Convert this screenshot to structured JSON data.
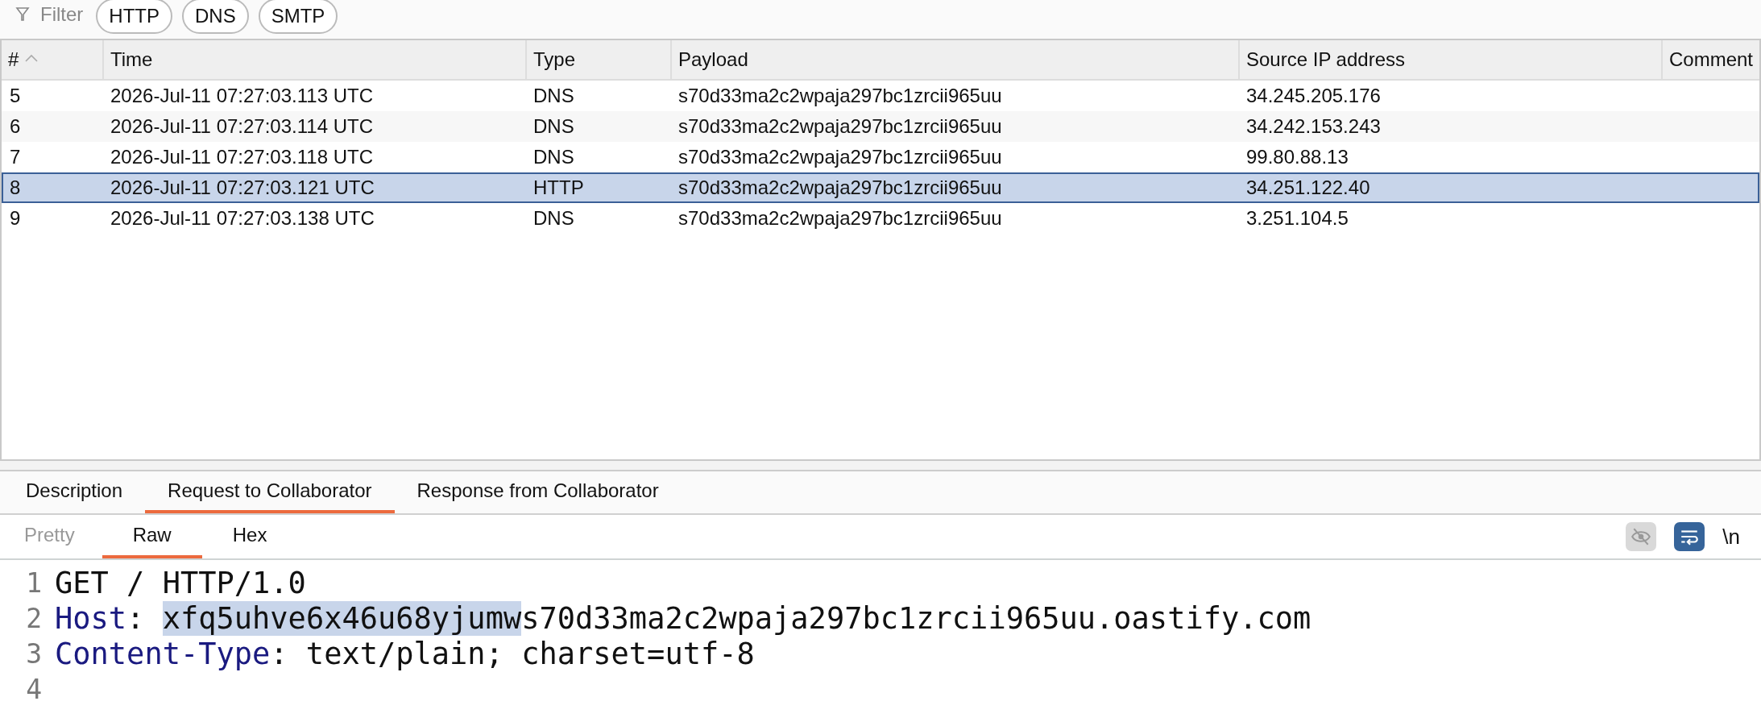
{
  "filter": {
    "label": "Filter",
    "chips": [
      "HTTP",
      "DNS",
      "SMTP"
    ]
  },
  "table": {
    "columns": [
      {
        "label": "#",
        "sorted": true
      },
      {
        "label": "Time",
        "sorted": false
      },
      {
        "label": "Type",
        "sorted": false
      },
      {
        "label": "Payload",
        "sorted": false
      },
      {
        "label": "Source IP address",
        "sorted": false
      },
      {
        "label": "Comment",
        "sorted": false
      }
    ],
    "rows": [
      {
        "cells": [
          "5",
          "2026-Jul-11 07:27:03.113 UTC",
          "DNS",
          "s70d33ma2c2wpaja297bc1zrcii965uu",
          "34.245.205.176"
        ],
        "selected": false
      },
      {
        "cells": [
          "6",
          "2026-Jul-11 07:27:03.114 UTC",
          "DNS",
          "s70d33ma2c2wpaja297bc1zrcii965uu",
          "34.242.153.243"
        ],
        "selected": false
      },
      {
        "cells": [
          "7",
          "2026-Jul-11 07:27:03.118 UTC",
          "DNS",
          "s70d33ma2c2wpaja297bc1zrcii965uu",
          "99.80.88.13"
        ],
        "selected": false
      },
      {
        "cells": [
          "8",
          "2026-Jul-11 07:27:03.121 UTC",
          "HTTP",
          "s70d33ma2c2wpaja297bc1zrcii965uu",
          "34.251.122.40"
        ],
        "selected": true
      },
      {
        "cells": [
          "9",
          "2026-Jul-11 07:27:03.138 UTC",
          "DNS",
          "s70d33ma2c2wpaja297bc1zrcii965uu",
          "3.251.104.5"
        ],
        "selected": false
      }
    ]
  },
  "detail_tabs": [
    {
      "label": "Description",
      "selected": false
    },
    {
      "label": "Request to Collaborator",
      "selected": true
    },
    {
      "label": "Response from Collaborator",
      "selected": false
    }
  ],
  "view_tabs": [
    {
      "label": "Pretty",
      "selected": false,
      "disabled": true
    },
    {
      "label": "Raw",
      "selected": true,
      "disabled": false
    },
    {
      "label": "Hex",
      "selected": false,
      "disabled": false
    }
  ],
  "toolbar": [
    {
      "kind": "eye",
      "on": false
    },
    {
      "kind": "wrap",
      "on": true
    },
    {
      "kind": "newline",
      "label": "\\n"
    }
  ],
  "editor": {
    "lines": [
      {
        "number": "1",
        "parts": [
          {
            "kind": "plain",
            "text": "GET / HTTP/1.0"
          }
        ]
      },
      {
        "number": "2",
        "parts": [
          {
            "kind": "key",
            "text": "Host"
          },
          {
            "kind": "plain",
            "text": ": "
          },
          {
            "kind": "selected",
            "text": "xfq5uhve6x46u68yjumw"
          },
          {
            "kind": "plain",
            "text": "s70d33ma2c2wpaja297bc1zrcii965uu.oastify.com"
          }
        ]
      },
      {
        "number": "3",
        "parts": [
          {
            "kind": "key",
            "text": "Content-Type"
          },
          {
            "kind": "plain",
            "text": ": text/plain; charset=utf-8"
          }
        ]
      },
      {
        "number": "4"
      }
    ]
  }
}
